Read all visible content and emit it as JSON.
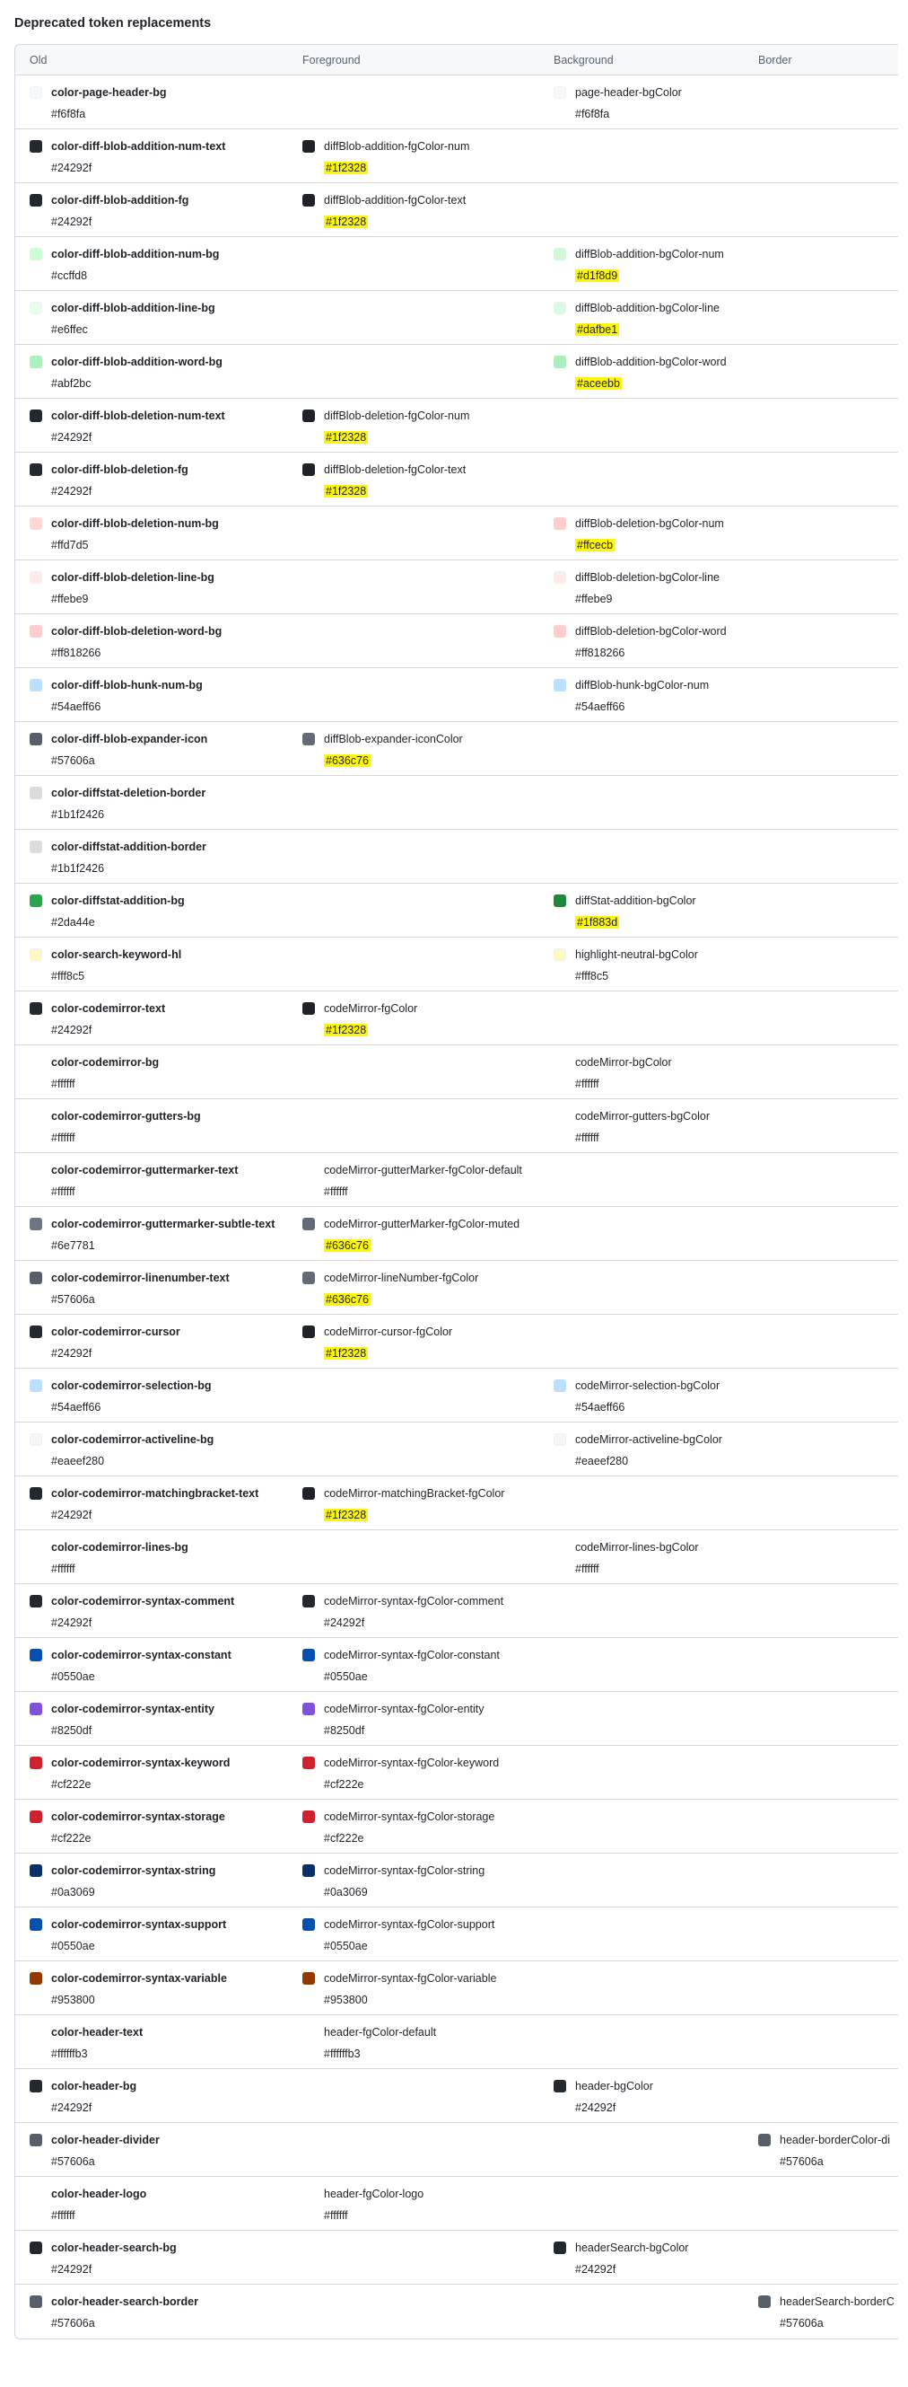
{
  "page": {
    "title": "Deprecated token replacements"
  },
  "table": {
    "headers": [
      "Old",
      "Foreground",
      "Background",
      "Border"
    ],
    "rows": [
      {
        "old": {
          "name": "color-page-header-bg",
          "value": "#f6f8fa",
          "color": "#f6f8fa"
        },
        "fg": null,
        "bg": {
          "name": "page-header-bgColor",
          "value": "#f6f8fa",
          "color": "#f6f8fa",
          "hl": false
        },
        "border": null
      },
      {
        "old": {
          "name": "color-diff-blob-addition-num-text",
          "value": "#24292f",
          "color": "#24292f"
        },
        "fg": {
          "name": "diffBlob-addition-fgColor-num",
          "value": "#1f2328",
          "color": "#1f2328",
          "hl": true
        },
        "bg": null,
        "border": null
      },
      {
        "old": {
          "name": "color-diff-blob-addition-fg",
          "value": "#24292f",
          "color": "#24292f"
        },
        "fg": {
          "name": "diffBlob-addition-fgColor-text",
          "value": "#1f2328",
          "color": "#1f2328",
          "hl": true
        },
        "bg": null,
        "border": null
      },
      {
        "old": {
          "name": "color-diff-blob-addition-num-bg",
          "value": "#ccffd8",
          "color": "#ccffd8"
        },
        "fg": null,
        "bg": {
          "name": "diffBlob-addition-bgColor-num",
          "value": "#d1f8d9",
          "color": "#d1f8d9",
          "hl": true
        },
        "border": null
      },
      {
        "old": {
          "name": "color-diff-blob-addition-line-bg",
          "value": "#e6ffec",
          "color": "#e6ffec"
        },
        "fg": null,
        "bg": {
          "name": "diffBlob-addition-bgColor-line",
          "value": "#dafbe1",
          "color": "#dafbe1",
          "hl": true
        },
        "border": null
      },
      {
        "old": {
          "name": "color-diff-blob-addition-word-bg",
          "value": "#abf2bc",
          "color": "#abf2bc"
        },
        "fg": null,
        "bg": {
          "name": "diffBlob-addition-bgColor-word",
          "value": "#aceebb",
          "color": "#aceebb",
          "hl": true
        },
        "border": null
      },
      {
        "old": {
          "name": "color-diff-blob-deletion-num-text",
          "value": "#24292f",
          "color": "#24292f"
        },
        "fg": {
          "name": "diffBlob-deletion-fgColor-num",
          "value": "#1f2328",
          "color": "#1f2328",
          "hl": true
        },
        "bg": null,
        "border": null
      },
      {
        "old": {
          "name": "color-diff-blob-deletion-fg",
          "value": "#24292f",
          "color": "#24292f"
        },
        "fg": {
          "name": "diffBlob-deletion-fgColor-text",
          "value": "#1f2328",
          "color": "#1f2328",
          "hl": true
        },
        "bg": null,
        "border": null
      },
      {
        "old": {
          "name": "color-diff-blob-deletion-num-bg",
          "value": "#ffd7d5",
          "color": "#ffd7d5"
        },
        "fg": null,
        "bg": {
          "name": "diffBlob-deletion-bgColor-num",
          "value": "#ffcecb",
          "color": "#ffcecb",
          "hl": true
        },
        "border": null
      },
      {
        "old": {
          "name": "color-diff-blob-deletion-line-bg",
          "value": "#ffebe9",
          "color": "#ffebe9"
        },
        "fg": null,
        "bg": {
          "name": "diffBlob-deletion-bgColor-line",
          "value": "#ffebe9",
          "color": "#ffebe9",
          "hl": false
        },
        "border": null
      },
      {
        "old": {
          "name": "color-diff-blob-deletion-word-bg",
          "value": "#ff818266",
          "color": "#ffcdcd"
        },
        "fg": null,
        "bg": {
          "name": "diffBlob-deletion-bgColor-word",
          "value": "#ff818266",
          "color": "#ffcdcd",
          "hl": false
        },
        "border": null
      },
      {
        "old": {
          "name": "color-diff-blob-hunk-num-bg",
          "value": "#54aeff66",
          "color": "#bbdfff"
        },
        "fg": null,
        "bg": {
          "name": "diffBlob-hunk-bgColor-num",
          "value": "#54aeff66",
          "color": "#bbdfff",
          "hl": false
        },
        "border": null
      },
      {
        "old": {
          "name": "color-diff-blob-expander-icon",
          "value": "#57606a",
          "color": "#57606a"
        },
        "fg": {
          "name": "diffBlob-expander-iconColor",
          "value": "#636c76",
          "color": "#636c76",
          "hl": true
        },
        "bg": null,
        "border": null
      },
      {
        "old": {
          "name": "color-diffstat-deletion-border",
          "value": "#1b1f2426",
          "color": "#dcdcdd"
        },
        "fg": null,
        "bg": null,
        "border": null
      },
      {
        "old": {
          "name": "color-diffstat-addition-border",
          "value": "#1b1f2426",
          "color": "#dcdcdd"
        },
        "fg": null,
        "bg": null,
        "border": null
      },
      {
        "old": {
          "name": "color-diffstat-addition-bg",
          "value": "#2da44e",
          "color": "#2da44e"
        },
        "fg": null,
        "bg": {
          "name": "diffStat-addition-bgColor",
          "value": "#1f883d",
          "color": "#1f883d",
          "hl": true
        },
        "border": null
      },
      {
        "old": {
          "name": "color-search-keyword-hl",
          "value": "#fff8c5",
          "color": "#fff8c5"
        },
        "fg": null,
        "bg": {
          "name": "highlight-neutral-bgColor",
          "value": "#fff8c5",
          "color": "#fff8c5",
          "hl": false
        },
        "border": null
      },
      {
        "old": {
          "name": "color-codemirror-text",
          "value": "#24292f",
          "color": "#24292f"
        },
        "fg": {
          "name": "codeMirror-fgColor",
          "value": "#1f2328",
          "color": "#1f2328",
          "hl": true
        },
        "bg": null,
        "border": null
      },
      {
        "old": {
          "name": "color-codemirror-bg",
          "value": "#ffffff",
          "color": "#ffffff"
        },
        "fg": null,
        "bg": {
          "name": "codeMirror-bgColor",
          "value": "#ffffff",
          "color": "#ffffff",
          "hl": false
        },
        "border": null
      },
      {
        "old": {
          "name": "color-codemirror-gutters-bg",
          "value": "#ffffff",
          "color": "#ffffff"
        },
        "fg": null,
        "bg": {
          "name": "codeMirror-gutters-bgColor",
          "value": "#ffffff",
          "color": "#ffffff",
          "hl": false
        },
        "border": null
      },
      {
        "old": {
          "name": "color-codemirror-guttermarker-text",
          "value": "#ffffff",
          "color": "#ffffff"
        },
        "fg": {
          "name": "codeMirror-gutterMarker-fgColor-default",
          "value": "#ffffff",
          "color": "#ffffff",
          "hl": false
        },
        "bg": null,
        "border": null
      },
      {
        "old": {
          "name": "color-codemirror-guttermarker-subtle-text",
          "value": "#6e7781",
          "color": "#6e7781"
        },
        "fg": {
          "name": "codeMirror-gutterMarker-fgColor-muted",
          "value": "#636c76",
          "color": "#636c76",
          "hl": true
        },
        "bg": null,
        "border": null
      },
      {
        "old": {
          "name": "color-codemirror-linenumber-text",
          "value": "#57606a",
          "color": "#57606a"
        },
        "fg": {
          "name": "codeMirror-lineNumber-fgColor",
          "value": "#636c76",
          "color": "#636c76",
          "hl": true
        },
        "bg": null,
        "border": null
      },
      {
        "old": {
          "name": "color-codemirror-cursor",
          "value": "#24292f",
          "color": "#24292f"
        },
        "fg": {
          "name": "codeMirror-cursor-fgColor",
          "value": "#1f2328",
          "color": "#1f2328",
          "hl": true
        },
        "bg": null,
        "border": null
      },
      {
        "old": {
          "name": "color-codemirror-selection-bg",
          "value": "#54aeff66",
          "color": "#bbdfff"
        },
        "fg": null,
        "bg": {
          "name": "codeMirror-selection-bgColor",
          "value": "#54aeff66",
          "color": "#bbdfff",
          "hl": false
        },
        "border": null
      },
      {
        "old": {
          "name": "color-codemirror-activeline-bg",
          "value": "#eaeef280",
          "color": "#f4f6f8"
        },
        "fg": null,
        "bg": {
          "name": "codeMirror-activeline-bgColor",
          "value": "#eaeef280",
          "color": "#f4f6f8",
          "hl": false
        },
        "border": null
      },
      {
        "old": {
          "name": "color-codemirror-matchingbracket-text",
          "value": "#24292f",
          "color": "#24292f"
        },
        "fg": {
          "name": "codeMirror-matchingBracket-fgColor",
          "value": "#1f2328",
          "color": "#1f2328",
          "hl": true
        },
        "bg": null,
        "border": null
      },
      {
        "old": {
          "name": "color-codemirror-lines-bg",
          "value": "#ffffff",
          "color": "#ffffff"
        },
        "fg": null,
        "bg": {
          "name": "codeMirror-lines-bgColor",
          "value": "#ffffff",
          "color": "#ffffff",
          "hl": false
        },
        "border": null
      },
      {
        "old": {
          "name": "color-codemirror-syntax-comment",
          "value": "#24292f",
          "color": "#24292f"
        },
        "fg": {
          "name": "codeMirror-syntax-fgColor-comment",
          "value": "#24292f",
          "color": "#24292f",
          "hl": false
        },
        "bg": null,
        "border": null
      },
      {
        "old": {
          "name": "color-codemirror-syntax-constant",
          "value": "#0550ae",
          "color": "#0550ae"
        },
        "fg": {
          "name": "codeMirror-syntax-fgColor-constant",
          "value": "#0550ae",
          "color": "#0550ae",
          "hl": false
        },
        "bg": null,
        "border": null
      },
      {
        "old": {
          "name": "color-codemirror-syntax-entity",
          "value": "#8250df",
          "color": "#8250df"
        },
        "fg": {
          "name": "codeMirror-syntax-fgColor-entity",
          "value": "#8250df",
          "color": "#8250df",
          "hl": false
        },
        "bg": null,
        "border": null
      },
      {
        "old": {
          "name": "color-codemirror-syntax-keyword",
          "value": "#cf222e",
          "color": "#cf222e"
        },
        "fg": {
          "name": "codeMirror-syntax-fgColor-keyword",
          "value": "#cf222e",
          "color": "#cf222e",
          "hl": false
        },
        "bg": null,
        "border": null
      },
      {
        "old": {
          "name": "color-codemirror-syntax-storage",
          "value": "#cf222e",
          "color": "#cf222e"
        },
        "fg": {
          "name": "codeMirror-syntax-fgColor-storage",
          "value": "#cf222e",
          "color": "#cf222e",
          "hl": false
        },
        "bg": null,
        "border": null
      },
      {
        "old": {
          "name": "color-codemirror-syntax-string",
          "value": "#0a3069",
          "color": "#0a3069"
        },
        "fg": {
          "name": "codeMirror-syntax-fgColor-string",
          "value": "#0a3069",
          "color": "#0a3069",
          "hl": false
        },
        "bg": null,
        "border": null
      },
      {
        "old": {
          "name": "color-codemirror-syntax-support",
          "value": "#0550ae",
          "color": "#0550ae"
        },
        "fg": {
          "name": "codeMirror-syntax-fgColor-support",
          "value": "#0550ae",
          "color": "#0550ae",
          "hl": false
        },
        "bg": null,
        "border": null
      },
      {
        "old": {
          "name": "color-codemirror-syntax-variable",
          "value": "#953800",
          "color": "#953800"
        },
        "fg": {
          "name": "codeMirror-syntax-fgColor-variable",
          "value": "#953800",
          "color": "#953800",
          "hl": false
        },
        "bg": null,
        "border": null
      },
      {
        "old": {
          "name": "color-header-text",
          "value": "#ffffffb3",
          "color": "#ffffff"
        },
        "fg": {
          "name": "header-fgColor-default",
          "value": "#ffffffb3",
          "color": "#ffffff",
          "hl": false
        },
        "bg": null,
        "border": null
      },
      {
        "old": {
          "name": "color-header-bg",
          "value": "#24292f",
          "color": "#24292f"
        },
        "fg": null,
        "bg": {
          "name": "header-bgColor",
          "value": "#24292f",
          "color": "#24292f",
          "hl": false
        },
        "border": null
      },
      {
        "old": {
          "name": "color-header-divider",
          "value": "#57606a",
          "color": "#57606a"
        },
        "fg": null,
        "bg": null,
        "border": {
          "name": "header-borderColor-di",
          "value": "#57606a",
          "color": "#57606a",
          "hl": false
        }
      },
      {
        "old": {
          "name": "color-header-logo",
          "value": "#ffffff",
          "color": "#ffffff"
        },
        "fg": {
          "name": "header-fgColor-logo",
          "value": "#ffffff",
          "color": "#ffffff",
          "hl": false
        },
        "bg": null,
        "border": null
      },
      {
        "old": {
          "name": "color-header-search-bg",
          "value": "#24292f",
          "color": "#24292f"
        },
        "fg": null,
        "bg": {
          "name": "headerSearch-bgColor",
          "value": "#24292f",
          "color": "#24292f",
          "hl": false
        },
        "border": null
      },
      {
        "old": {
          "name": "color-header-search-border",
          "value": "#57606a",
          "color": "#57606a"
        },
        "fg": null,
        "bg": null,
        "border": {
          "name": "headerSearch-borderC",
          "value": "#57606a",
          "color": "#57606a",
          "hl": false
        }
      }
    ]
  }
}
